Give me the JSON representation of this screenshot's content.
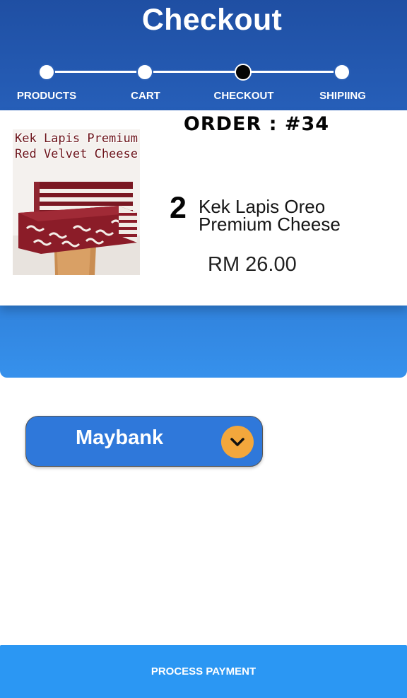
{
  "header": {
    "title": "Checkout",
    "steps": [
      {
        "label": "PRODUCTS",
        "state": "done"
      },
      {
        "label": "CART",
        "state": "done"
      },
      {
        "label": "CHECKOUT",
        "state": "current"
      },
      {
        "label": "SHIPIING",
        "state": "pending"
      }
    ]
  },
  "order": {
    "label": "ORDER : #34",
    "item": {
      "image_caption": [
        "Kek Lapis Premium",
        "Red Velvet Cheese"
      ],
      "quantity": "2",
      "name_lines": [
        "Kek Lapis Oreo",
        "Premium Cheese"
      ],
      "price": "RM 26.00"
    }
  },
  "payment": {
    "selected_bank": "Maybank",
    "dropdown_icon": "chevron-down-icon"
  },
  "actions": {
    "process_payment_label": "PROCESS PAYMENT"
  },
  "colors": {
    "header_top": "#1f4fa3",
    "header_bottom": "#3691ec",
    "select_bg": "#2f78da",
    "chevron_bg": "#f3a73c",
    "pay_button_bg": "#2b97f3"
  }
}
